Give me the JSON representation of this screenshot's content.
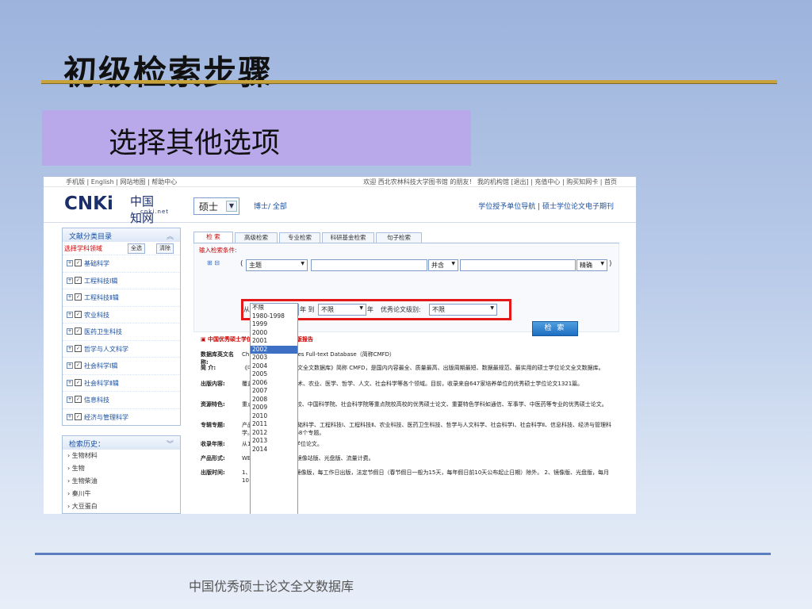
{
  "slide": {
    "title": "初级检索步骤",
    "subtitle": "选择其他选项",
    "footer": "中国优秀硕士论文全文数据库"
  },
  "topbar": {
    "left": "手机版 | English | 网站地图 | 帮助中心",
    "right": "欢迎  西北农林科技大学图书馆 的朋友！ 我的机构馆 [退出] | 充值中心 | 购买知网卡 | 首页"
  },
  "header": {
    "logo_en": "CNKi",
    "logo_cn": "中国知网",
    "logo_domain": "cnki.net",
    "db_select": "硕士",
    "sub_links": "博士/ 全部",
    "nav_right": "学位授予单位导航  |  硕士学位论文电子期刊"
  },
  "sidebar": {
    "panel_title": "文献分类目录",
    "select_label": "选择学科领域",
    "select_all": "全选",
    "clear": "清除",
    "categories": [
      "基础科学",
      "工程科技Ⅰ辑",
      "工程科技Ⅱ辑",
      "农业科技",
      "医药卫生科技",
      "哲学与人文科学",
      "社会科学Ⅰ辑",
      "社会科学Ⅱ辑",
      "信息科技",
      "经济与管理科学"
    ],
    "history_title": "检索历史：",
    "history": [
      "生物材料",
      "生物",
      "生物柴油",
      "秦川牛",
      "大豆蛋白"
    ]
  },
  "tabs": [
    "检 索",
    "高级检索",
    "专业检索",
    "科研基金检索",
    "句子检索"
  ],
  "form": {
    "label": "输入检索条件:",
    "field": "主题",
    "op": "并含",
    "match": "精确",
    "from_prefix": "从",
    "from_year": "2002",
    "to_label": "年 到",
    "to_year": "不限",
    "year_suffix": "年",
    "level_label": "优秀论文级别:",
    "level": "不限",
    "search_btn": "检 索"
  },
  "dropdown_years": [
    "不限",
    "1980-1998",
    "1999",
    "2000",
    "2001",
    "2002",
    "2003",
    "2004",
    "2005",
    "2006",
    "2007",
    "2008",
    "2009",
    "2010",
    "2011",
    "2012",
    "2013",
    "2014"
  ],
  "dropdown_selected": "2002",
  "info": {
    "news": "▣ 中国优秀硕士学位论文全文数据库出版报告",
    "rows": [
      {
        "k": "数据库英文名称:",
        "v": "China Master's Theses Full-text Database（简称CMFD）"
      },
      {
        "k": "简  介:",
        "v": "《中国优秀硕士学位论文全文数据库》简称 CMFD，是国内内容最全、质量最高、出版周期最短、数据最规范、最实用的硕士学位论文全文数据库。"
      },
      {
        "k": "出版内容:",
        "v": "覆盖基础科学、工程技术、农业、医学、哲学、人文、社会科学等各个领域。目前，收录来自647家培养单位的优秀硕士学位论文1321篇。"
      },
      {
        "k": "资源特色:",
        "v": "重点收录985、211高校、中国科学院、社会科学院等重点院校高校的优秀硕士论文、重要特色学科如通信、军事学、中医药等专业的优秀硕士论文。"
      },
      {
        "k": "专辑专题:",
        "v": "产品分为十大专辑：基础科学、工程科技Ⅰ、工程科技Ⅱ、农业科技、医药卫生科技、哲学与人文科学、社会科学Ⅰ、社会科学Ⅱ、信息科技、经济与管理科学。十大专辑下分为168个专题。"
      },
      {
        "k": "收录年限:",
        "v": "从1984年至今的硕士学位论文。"
      },
      {
        "k": "产品形式:",
        "v": "WEB版（网上包库）、镜像站版、光盘版、流量计费。"
      },
      {
        "k": "出版时间:",
        "v": "1、中心网站版、网络镜像版，每工作日出版，法定节假日（春节假日一般为15天，每年假日前10天公布起止日期）除外。 2、镜像版、光盘版，每月10日出版。"
      }
    ]
  }
}
